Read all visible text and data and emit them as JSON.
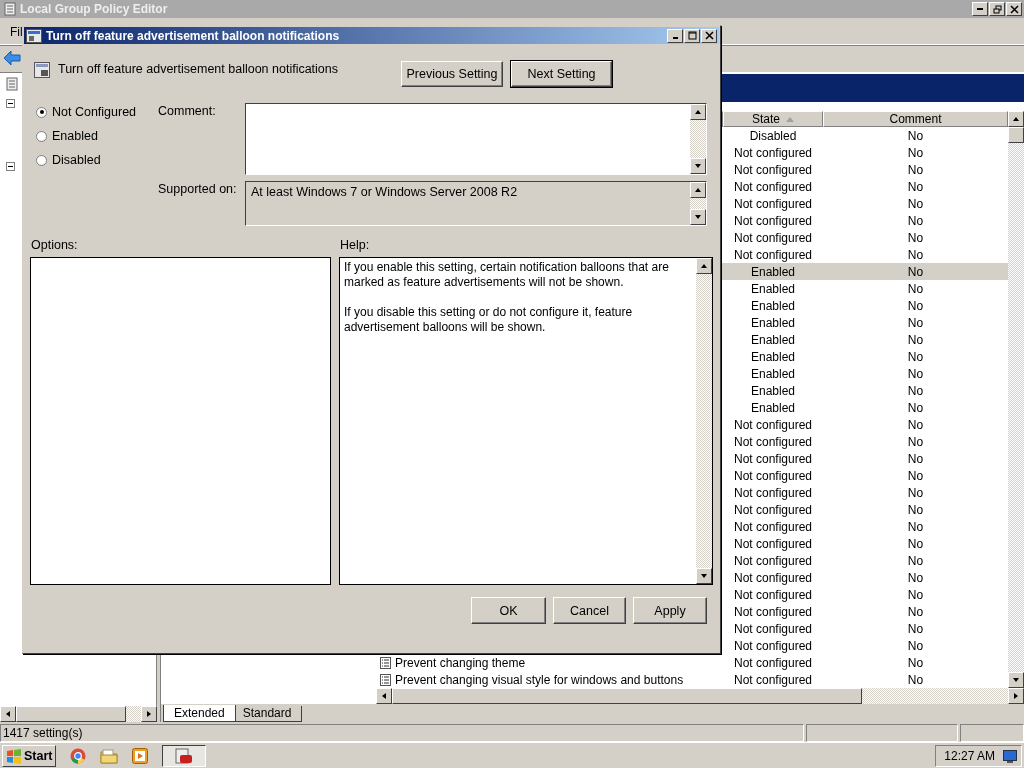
{
  "main_window": {
    "title": "Local Group Policy Editor",
    "menu": [
      "Fil"
    ],
    "list": {
      "columns": [
        {
          "label": "State",
          "sorted": true
        },
        {
          "label": "Comment",
          "sorted": false
        }
      ],
      "rows": [
        {
          "state": "Disabled",
          "comment": "No",
          "selected": false
        },
        {
          "state": "Not configured",
          "comment": "No",
          "selected": false
        },
        {
          "state": "Not configured",
          "comment": "No",
          "selected": false
        },
        {
          "state": "Not configured",
          "comment": "No",
          "selected": false
        },
        {
          "state": "Not configured",
          "comment": "No",
          "selected": false
        },
        {
          "state": "Not configured",
          "comment": "No",
          "selected": false
        },
        {
          "state": "Not configured",
          "comment": "No",
          "selected": false
        },
        {
          "state": "Not configured",
          "comment": "No",
          "selected": false
        },
        {
          "state": "Enabled",
          "comment": "No",
          "selected": true
        },
        {
          "state": "Enabled",
          "comment": "No",
          "selected": false
        },
        {
          "state": "Enabled",
          "comment": "No",
          "selected": false
        },
        {
          "state": "Enabled",
          "comment": "No",
          "selected": false
        },
        {
          "state": "Enabled",
          "comment": "No",
          "selected": false
        },
        {
          "state": "Enabled",
          "comment": "No",
          "selected": false
        },
        {
          "state": "Enabled",
          "comment": "No",
          "selected": false
        },
        {
          "state": "Enabled",
          "comment": "No",
          "selected": false
        },
        {
          "state": "Enabled",
          "comment": "No",
          "selected": false
        },
        {
          "state": "Not configured",
          "comment": "No",
          "selected": false
        },
        {
          "state": "Not configured",
          "comment": "No",
          "selected": false
        },
        {
          "state": "Not configured",
          "comment": "No",
          "selected": false
        },
        {
          "state": "Not configured",
          "comment": "No",
          "selected": false
        },
        {
          "state": "Not configured",
          "comment": "No",
          "selected": false
        },
        {
          "state": "Not configured",
          "comment": "No",
          "selected": false
        },
        {
          "state": "Not configured",
          "comment": "No",
          "selected": false
        },
        {
          "state": "Not configured",
          "comment": "No",
          "selected": false
        },
        {
          "state": "Not configured",
          "comment": "No",
          "selected": false
        },
        {
          "state": "Not configured",
          "comment": "No",
          "selected": false
        },
        {
          "state": "Not configured",
          "comment": "No",
          "selected": false
        },
        {
          "state": "Not configured",
          "comment": "No",
          "selected": false
        },
        {
          "state": "Not configured",
          "comment": "No",
          "selected": false
        },
        {
          "state": "Not configured",
          "comment": "No",
          "selected": false
        },
        {
          "setting": "Prevent changing theme",
          "state": "Not configured",
          "comment": "No",
          "selected": false
        },
        {
          "setting": "Prevent changing visual style for windows and buttons",
          "state": "Not configured",
          "comment": "No",
          "selected": false
        }
      ]
    },
    "view_tabs": [
      {
        "label": "Extended",
        "selected": true
      },
      {
        "label": "Standard",
        "selected": false
      }
    ],
    "status_bar": "1417 setting(s)"
  },
  "dialog": {
    "title": "Turn off feature advertisement balloon notifications",
    "setting_name": "Turn off feature advertisement balloon notifications",
    "nav_buttons": [
      {
        "label": "Previous Setting",
        "focused": false
      },
      {
        "label": "Next Setting",
        "focused": true
      }
    ],
    "radios": [
      {
        "label": "Not Configured",
        "selected": true
      },
      {
        "label": "Enabled",
        "selected": false
      },
      {
        "label": "Disabled",
        "selected": false
      }
    ],
    "comment_label": "Comment:",
    "supported_label": "Supported on:",
    "supported_value": "At least Windows 7 or Windows Server 2008 R2",
    "options_label": "Options:",
    "help_label": "Help:",
    "help_paragraphs": [
      "If you enable this setting, certain notification balloons that are marked as feature advertisements will not be shown.",
      "If you disable this setting or do not configure it, feature advertisement balloons will be shown."
    ],
    "buttons": [
      "OK",
      "Cancel",
      "Apply"
    ]
  },
  "taskbar": {
    "start": "Start",
    "clock": "12:27 AM"
  }
}
